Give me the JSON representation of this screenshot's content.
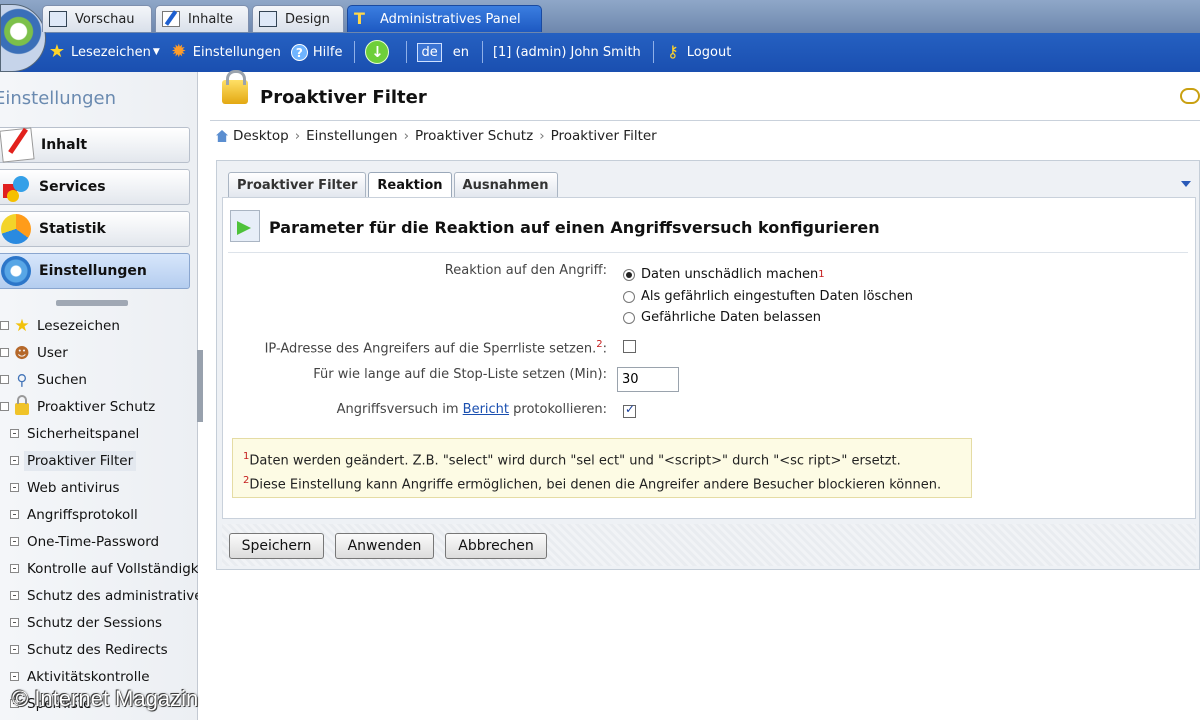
{
  "top_tabs": [
    {
      "label": "Vorschau",
      "icon": "monitor-icon"
    },
    {
      "label": "Inhalte",
      "icon": "pencil-icon"
    },
    {
      "label": "Design",
      "icon": "design-icon"
    },
    {
      "label": "Administratives Panel",
      "icon": "tools-icon",
      "active": true
    }
  ],
  "toolbar": {
    "bookmarks": "Lesezeichen",
    "settings": "Einstellungen",
    "help": "Hilfe",
    "lang_de": "de",
    "lang_en": "en",
    "user": "[1] (admin) John Smith",
    "logout": "Logout"
  },
  "sidebar": {
    "title": "Einstellungen",
    "buttons": [
      "Inhalt",
      "Services",
      "Statistik",
      "Einstellungen"
    ],
    "tree": [
      {
        "label": "Lesezeichen",
        "level": 1,
        "icon": "star-icon"
      },
      {
        "label": "User",
        "level": 1,
        "icon": "user-icon"
      },
      {
        "label": "Suchen",
        "level": 1,
        "icon": "search-icon"
      },
      {
        "label": "Proaktiver Schutz",
        "level": 1,
        "icon": "lock-icon"
      },
      {
        "label": "Sicherheitspanel",
        "level": 2
      },
      {
        "label": "Proaktiver Filter",
        "level": 2,
        "selected": true
      },
      {
        "label": "Web antivirus",
        "level": 2
      },
      {
        "label": "Angriffsprotokoll",
        "level": 2
      },
      {
        "label": "One-Time-Password",
        "level": 2
      },
      {
        "label": "Kontrolle auf Vollständigke",
        "level": 2
      },
      {
        "label": "Schutz des administrativer",
        "level": 2
      },
      {
        "label": "Schutz der Sessions",
        "level": 2
      },
      {
        "label": "Schutz des Redirects",
        "level": 2
      },
      {
        "label": "Aktivitätskontrolle",
        "level": 2
      },
      {
        "label": "Sperrliste",
        "level": 2
      }
    ]
  },
  "watermark": "© Internet Magazin",
  "page": {
    "title": "Proaktiver Filter",
    "breadcrumb": [
      "Desktop",
      "Einstellungen",
      "Proaktiver Schutz",
      "Proaktiver Filter"
    ]
  },
  "panel_tabs": [
    {
      "label": "Proaktiver Filter"
    },
    {
      "label": "Reaktion",
      "active": true
    },
    {
      "label": "Ausnahmen"
    }
  ],
  "section": {
    "title": "Parameter für die Reaktion auf einen Angriffsversuch konfigurieren"
  },
  "form": {
    "reaction_label": "Reaktion auf den Angriff:",
    "options": [
      {
        "label": "Daten unschädlich machen",
        "sup": "1",
        "selected": true
      },
      {
        "label": "Als gefährlich eingestuften Daten löschen",
        "sup": "",
        "selected": false
      },
      {
        "label": "Gefährliche Daten belassen",
        "sup": "",
        "selected": false
      }
    ],
    "ip_label": "IP-Adresse des Angreifers auf die Sperrliste setzen.",
    "ip_sup": "2",
    "ip_colon": ":",
    "ip_checked": false,
    "duration_label": "Für wie lange auf die Stop-Liste setzen (Min):",
    "duration_value": "30",
    "log_label_pre": "Angriffsversuch im",
    "log_link": "Bericht",
    "log_label_post": "protokollieren:",
    "log_checked": true
  },
  "notes": [
    {
      "num": "1",
      "text": "Daten werden geändert. Z.B. \"select\" wird durch \"sel ect\" und \"<script>\" durch \"<sc ript>\" ersetzt."
    },
    {
      "num": "2",
      "text": "Diese Einstellung kann Angriffe ermöglichen, bei denen die Angreifer andere Besucher blockieren können."
    }
  ],
  "buttons": {
    "save": "Speichern",
    "apply": "Anwenden",
    "cancel": "Abbrechen"
  }
}
